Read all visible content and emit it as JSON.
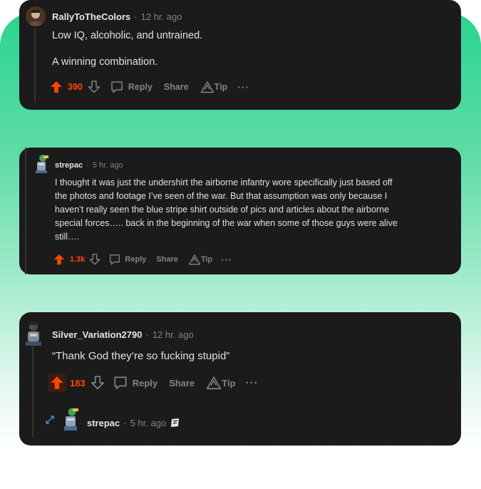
{
  "comments": [
    {
      "username": "RallyToTheColors",
      "time": "12 hr. ago",
      "lines": [
        "Low IQ, alcoholic, and untrained.",
        "A winning combination."
      ],
      "score": "390",
      "reply_label": "Reply",
      "share_label": "Share",
      "tip_label": "Tip"
    },
    {
      "username": "strepac",
      "time": "5 hr. ago",
      "lines": [
        "I thought it was just the undershirt the airborne infantry wore specifically just based off",
        "the photos and footage I’ve seen of the war. But that assumption was only because I",
        "haven’t really seen the blue stripe shirt outside of pics and articles about the airborne",
        "special forces….. back in the beginning of the war when some of those guys were alive",
        "still…."
      ],
      "score": "1.3k",
      "reply_label": "Reply",
      "share_label": "Share",
      "tip_label": "Tip"
    },
    {
      "username": "Silver_Variation2790",
      "time": "12 hr. ago",
      "lines": [
        "“Thank God they’re so fucking stupid”"
      ],
      "score": "183",
      "reply_label": "Reply",
      "share_label": "Share",
      "tip_label": "Tip",
      "reply": {
        "username": "strepac",
        "time": "5 hr. ago"
      }
    }
  ],
  "colors": {
    "upvote": "#ff4500",
    "card": "#1b1b1b",
    "muted": "#818384",
    "gradient_top": "#2bd48f"
  }
}
